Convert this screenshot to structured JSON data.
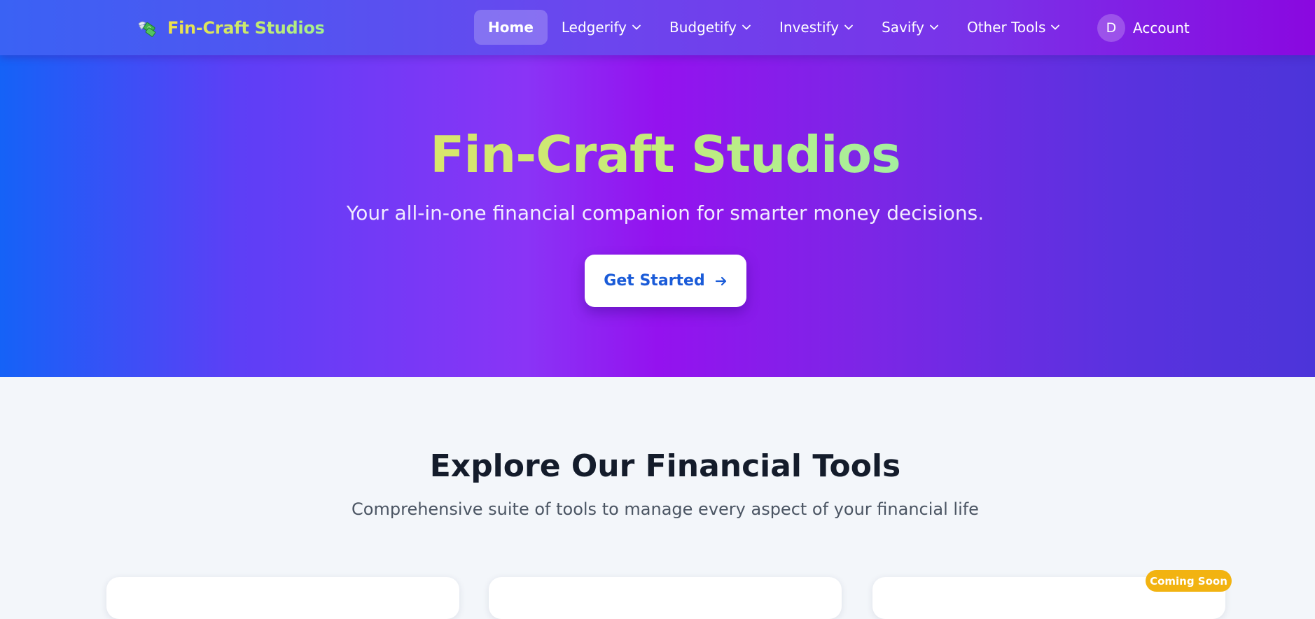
{
  "navbar": {
    "brand": {
      "name": "Fin-Craft Studios",
      "icon": "money-with-wings-icon"
    },
    "items": [
      {
        "label": "Home",
        "active": true,
        "has_dropdown": false
      },
      {
        "label": "Ledgerify",
        "active": false,
        "has_dropdown": true
      },
      {
        "label": "Budgetify",
        "active": false,
        "has_dropdown": true
      },
      {
        "label": "Investify",
        "active": false,
        "has_dropdown": true
      },
      {
        "label": "Savify",
        "active": false,
        "has_dropdown": true
      },
      {
        "label": "Other Tools",
        "active": false,
        "has_dropdown": true
      }
    ],
    "account": {
      "avatar_initial": "D",
      "label": "Account"
    }
  },
  "hero": {
    "title": "Fin-Craft Studios",
    "subtitle": "Your all-in-one financial companion for smarter money decisions.",
    "cta_label": "Get Started",
    "cta_icon": "arrow-right-icon"
  },
  "tools_section": {
    "title": "Explore Our Financial Tools",
    "subtitle": "Comprehensive suite of tools to manage every aspect of your financial life",
    "cards": [
      {
        "badge": ""
      },
      {
        "badge": ""
      },
      {
        "badge": "Coming Soon"
      }
    ]
  },
  "colors": {
    "nav_gradient_start": "#3a62f4",
    "nav_gradient_end": "#8a08e0",
    "hero_gradient_start": "#1562f7",
    "hero_gradient_mid": "#9412ef",
    "hero_gradient_end": "#4c34d9",
    "brand_text_start": "#f0e14a",
    "brand_text_end": "#a3f08f",
    "cta_text": "#1a5bd8",
    "section_bg": "#f3f6fa",
    "section_title": "#141c2b",
    "badge_bg": "#f2b311"
  }
}
